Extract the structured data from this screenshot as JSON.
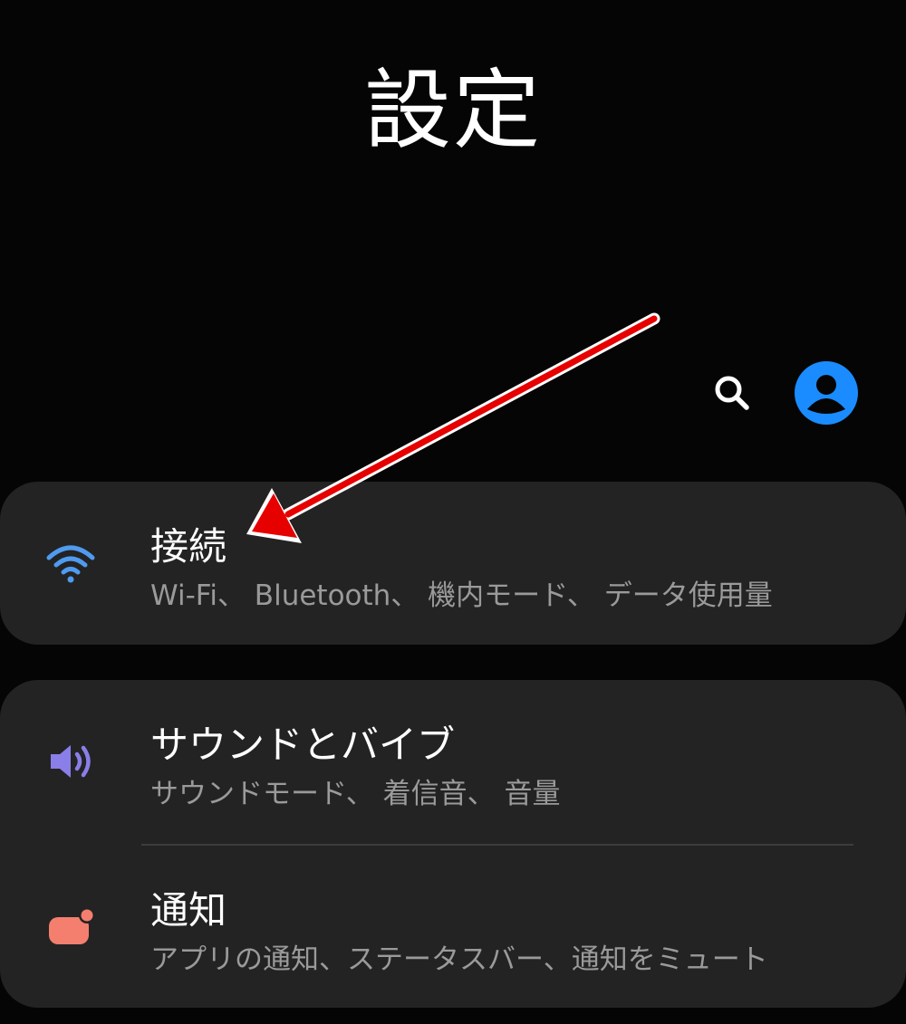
{
  "header": {
    "title": "設定"
  },
  "toolbar": {
    "search_icon": "search-icon",
    "profile_icon": "account-avatar-icon",
    "accent_color": "#1a8cff"
  },
  "menu": {
    "items": [
      {
        "title": "接続",
        "subtitle": "Wi-Fi、 Bluetooth、 機内モード、 データ使用量",
        "icon": "wifi-icon",
        "icon_color": "#4f9bf0"
      },
      {
        "title": "サウンドとバイブ",
        "subtitle": "サウンドモード、 着信音、 音量",
        "icon": "volume-icon",
        "icon_color": "#8a7ee8"
      },
      {
        "title": "通知",
        "subtitle": "アプリの通知、ステータスバー、通知をミュート",
        "icon": "notification-icon",
        "icon_color": "#f47f6e"
      }
    ]
  },
  "annotation": {
    "arrow_color": "#e60000"
  }
}
